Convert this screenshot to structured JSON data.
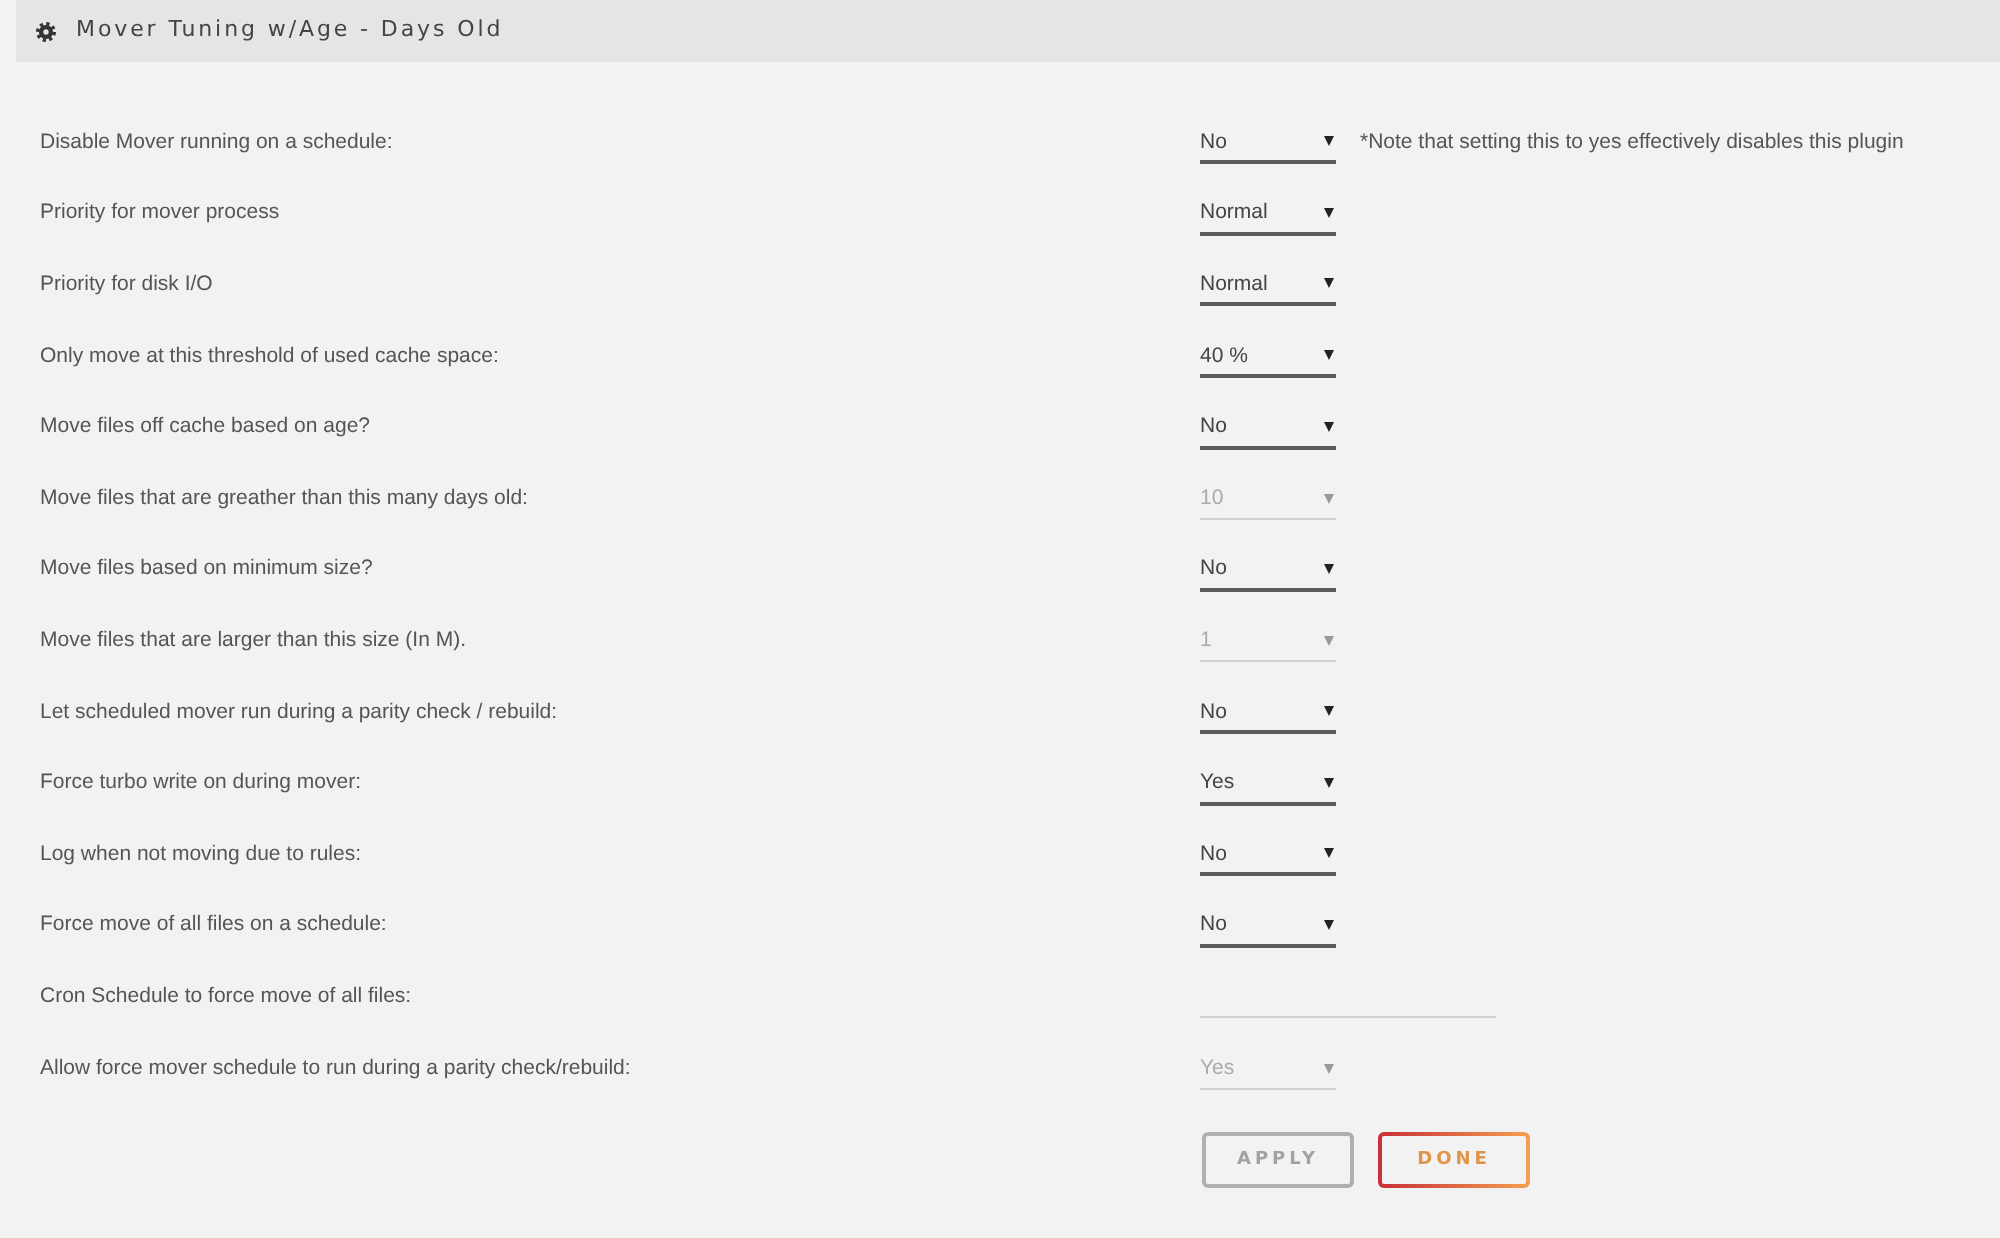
{
  "header": {
    "title": "Mover Tuning w/Age - Days Old"
  },
  "settings": [
    {
      "label": "Disable Mover running on a schedule:",
      "kind": "select",
      "value": "No",
      "disabled": false,
      "note": "*Note that setting this to yes effectively disables this plugin"
    },
    {
      "label": "Priority for mover process",
      "kind": "select",
      "value": "Normal",
      "disabled": false
    },
    {
      "label": "Priority for disk I/O",
      "kind": "select",
      "value": "Normal",
      "disabled": false
    },
    {
      "label": "Only move at this threshold of used cache space:",
      "kind": "select",
      "value": "40 %",
      "disabled": false
    },
    {
      "label": "Move files off cache based on age?",
      "kind": "select",
      "value": "No",
      "disabled": false
    },
    {
      "label": "Move files that are greather than this many days old:",
      "kind": "select",
      "value": "10",
      "disabled": true
    },
    {
      "label": "Move files based on minimum size?",
      "kind": "select",
      "value": "No",
      "disabled": false
    },
    {
      "label": "Move files that are larger than this size (In M).",
      "kind": "select",
      "value": "1",
      "disabled": true
    },
    {
      "label": "Let scheduled mover run during a parity check / rebuild:",
      "kind": "select",
      "value": "No",
      "disabled": false
    },
    {
      "label": "Force turbo write on during mover:",
      "kind": "select",
      "value": "Yes",
      "disabled": false
    },
    {
      "label": "Log when not moving due to rules:",
      "kind": "select",
      "value": "No",
      "disabled": false
    },
    {
      "label": "Force move of all files on a schedule:",
      "kind": "select",
      "value": "No",
      "disabled": false
    },
    {
      "label": "Cron Schedule to force move of all files:",
      "kind": "text"
    },
    {
      "label": "Allow force mover schedule to run during a parity check/rebuild:",
      "kind": "select",
      "value": "Yes",
      "disabled": true
    }
  ],
  "buttons": [
    {
      "label": "APPLY",
      "disabled": true
    },
    {
      "label": "DONE",
      "disabled": false
    }
  ]
}
